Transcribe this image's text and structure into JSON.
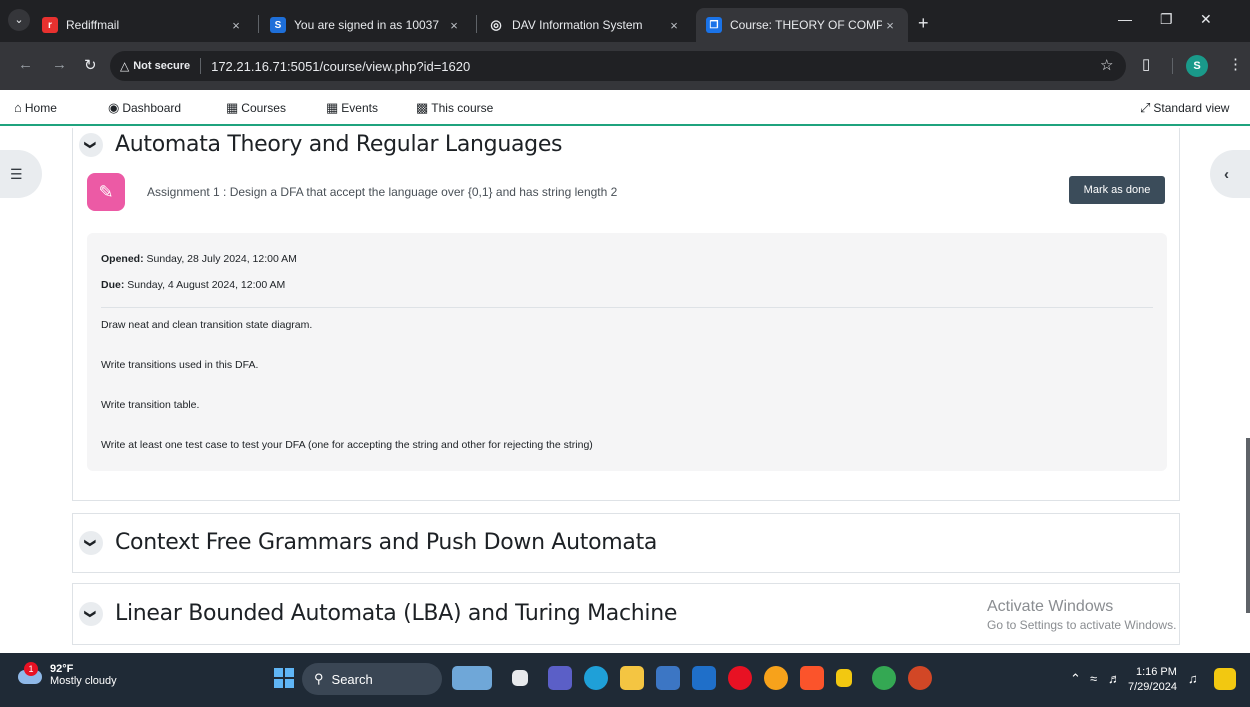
{
  "browser": {
    "tabs": [
      {
        "title": "Rediffmail",
        "favicon": "rediffmail-icon",
        "fav_color": "#e8312f",
        "fav_glyph": "r"
      },
      {
        "title": "You are signed in as 10037",
        "favicon": "s-logo-icon",
        "fav_color": "#1e6fd9",
        "fav_glyph": "S"
      },
      {
        "title": "DAV Information System",
        "favicon": "globe-icon",
        "fav_color": "#5f6368",
        "fav_glyph": "◎"
      },
      {
        "title": "Course: THEORY OF COMPUTE",
        "favicon": "moodle-icon",
        "fav_color": "#1a73e8",
        "fav_glyph": "❐",
        "active": true
      }
    ],
    "tab_close": "×",
    "new_tab": "+",
    "url_warning": "Not secure",
    "url": "172.21.16.71:5051/course/view.php?id=1620",
    "profile_initial": "S"
  },
  "moodle_nav": {
    "home": "Home",
    "dashboard": "Dashboard",
    "courses": "Courses",
    "events": "Events",
    "this_course": "This course",
    "standard_view": "Standard view"
  },
  "sections": [
    {
      "title": "Automata Theory and Regular Languages",
      "expanded": true
    },
    {
      "title": "Context Free Grammars and Push Down Automata",
      "expanded": false
    },
    {
      "title": "Linear Bounded Automata (LBA) and Turing Machine",
      "expanded": false
    }
  ],
  "activity": {
    "name": "Assignment 1 : Design a DFA that accept the language over {0,1} and has string length 2",
    "mark_done": "Mark as done",
    "opened_label": "Opened:",
    "opened_value": "Sunday, 28 July 2024, 12:00 AM",
    "due_label": "Due:",
    "due_value": "Sunday, 4 August 2024, 12:00 AM",
    "description": [
      "Draw neat and clean transition state diagram.",
      "Write transitions used in this DFA.",
      "Write transition table.",
      "Write at least one test case to test your DFA (one for accepting the string and other for rejecting the string)"
    ]
  },
  "watermark": {
    "line1": "Activate Windows",
    "line2": "Go to Settings to activate Windows."
  },
  "taskbar": {
    "temperature": "92°F",
    "weather": "Mostly cloudy",
    "weather_badge": "1",
    "search": "Search",
    "time": "1:16 PM",
    "date": "7/29/2024"
  },
  "colors": {
    "accent_line": "#1fa37e",
    "assignment_icon": "#ec5aa5",
    "mark_done_button": "#3b4c5a",
    "browser_dark": "#202124"
  }
}
